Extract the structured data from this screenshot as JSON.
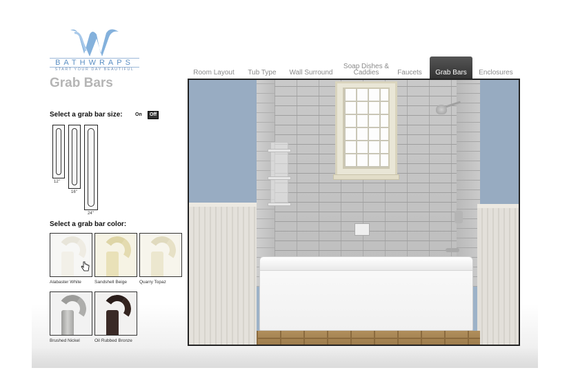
{
  "brand": {
    "name": "BATHWRAPS",
    "tagline": "START YOUR DAY BEAUTIFUL",
    "logo_color": "#5b8fc4"
  },
  "page_title": "Grab Bars",
  "tabs": [
    {
      "label": "Room Layout",
      "active": false
    },
    {
      "label": "Tub Type",
      "active": false
    },
    {
      "label": "Wall Surround",
      "active": false
    },
    {
      "label": "Soap Dishes & Caddies",
      "active": false
    },
    {
      "label": "Faucets",
      "active": false
    },
    {
      "label": "Grab Bars",
      "active": true
    },
    {
      "label": "Enclosures",
      "active": false
    }
  ],
  "size_selector": {
    "label": "Select a grab bar size:",
    "on_label": "On",
    "off_label": "Off",
    "sizes": [
      {
        "label": "12\""
      },
      {
        "label": "16\""
      },
      {
        "label": "24\""
      }
    ]
  },
  "color_selector": {
    "label": "Select a grab bar color:",
    "options": [
      {
        "label": "Alabaster White",
        "color": "#f2f0e8"
      },
      {
        "label": "Sandshell Beige",
        "color": "#e9e1b8"
      },
      {
        "label": "Quarry Topaz",
        "color": "#ece7cf"
      },
      {
        "label": "Brushed Nickel",
        "color": "#b8b8b6"
      },
      {
        "label": "Oil Rubbed Bronze",
        "color": "#3a2a26"
      }
    ]
  },
  "viewer": {
    "wall_color": "#98acc2",
    "tile_color": "#c4c4c4",
    "floor_color": "#a8865a"
  }
}
